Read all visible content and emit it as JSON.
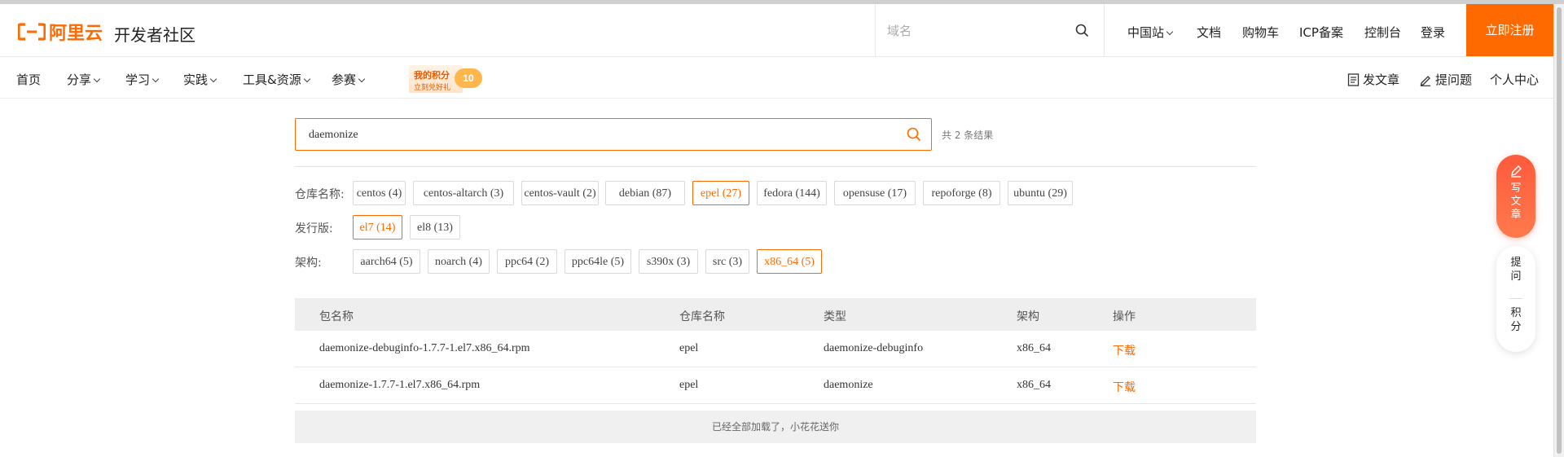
{
  "header": {
    "logo_text": "阿里云",
    "site_name": "开发者社区",
    "search_placeholder": "域名",
    "nav": {
      "china": "中国站",
      "docs": "文档",
      "cart": "购物车",
      "icp": "ICP备案",
      "console": "控制台",
      "login": "登录",
      "register": "立即注册"
    }
  },
  "subnav": {
    "items": [
      "首页",
      "分享",
      "学习",
      "实践",
      "工具&资源",
      "参赛"
    ],
    "points_title": "我的积分",
    "points_sub": "立刻兑好礼",
    "points_value": "10",
    "write_article": "发文章",
    "ask_question": "提问题",
    "personal_center": "个人中心"
  },
  "search": {
    "value": "daemonize",
    "result_count": "共 2 条结果"
  },
  "filters": {
    "repo": {
      "label": "仓库名称:",
      "options": [
        "centos (4)",
        "centos-altarch (3)",
        "centos-vault (2)",
        "debian (87)",
        "epel (27)",
        "fedora (144)",
        "opensuse (17)",
        "repoforge (8)",
        "ubuntu (29)"
      ],
      "selected": "epel (27)"
    },
    "release": {
      "label": "发行版:",
      "options": [
        "el7 (14)",
        "el8 (13)"
      ],
      "selected": "el7 (14)"
    },
    "arch": {
      "label": "架构:",
      "options": [
        "aarch64 (5)",
        "noarch (4)",
        "ppc64 (2)",
        "ppc64le (5)",
        "s390x (3)",
        "src (3)",
        "x86_64 (5)"
      ],
      "selected": "x86_64 (5)"
    }
  },
  "table": {
    "headers": [
      "包名称",
      "仓库名称",
      "类型",
      "架构",
      "操作"
    ],
    "rows": [
      [
        "daemonize-debuginfo-1.7.7-1.el7.x86_64.rpm",
        "epel",
        "daemonize-debuginfo",
        "x86_64",
        "下载"
      ],
      [
        "daemonize-1.7.7-1.el7.x86_64.rpm",
        "epel",
        "daemonize",
        "x86_64",
        "下载"
      ]
    ],
    "footer": "已经全部加载了，小花花送你"
  },
  "float": {
    "write": [
      "写",
      "文",
      "章"
    ],
    "ask": [
      "提",
      "问"
    ],
    "points": [
      "积",
      "分"
    ]
  },
  "colors": {
    "brand": "#ff6a00",
    "float_write": "#ff5a3c"
  }
}
